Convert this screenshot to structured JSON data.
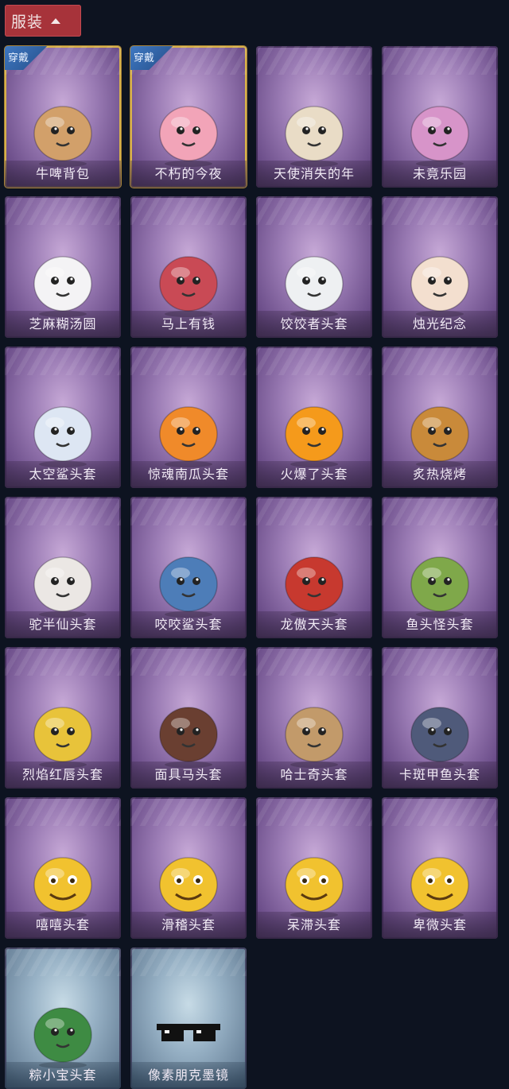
{
  "header": {
    "title": "服装",
    "chevron_icon": "chevron-up-icon"
  },
  "equipped_tag": "穿戴",
  "items": [
    {
      "name": "牛啤背包",
      "icon": "cow-barrel-backpack-icon",
      "theme": "purple",
      "equipped": true,
      "color": "#d2a06a"
    },
    {
      "name": "不朽的今夜",
      "icon": "pink-fox-bowl-icon",
      "theme": "purple",
      "equipped": true,
      "color": "#f2a4b8"
    },
    {
      "name": "天使消失的年",
      "icon": "angel-girl-icon",
      "theme": "purple",
      "equipped": false,
      "color": "#e9dcc6"
    },
    {
      "name": "未竟乐园",
      "icon": "fairy-girl-icon",
      "theme": "purple",
      "equipped": false,
      "color": "#d794c9"
    },
    {
      "name": "芝麻糊汤圆",
      "icon": "dumpling-head-icon",
      "theme": "purple",
      "equipped": false,
      "color": "#f4f3f5"
    },
    {
      "name": "马上有钱",
      "icon": "red-horse-head-icon",
      "theme": "purple",
      "equipped": false,
      "color": "#c94a55"
    },
    {
      "name": "饺饺者头套",
      "icon": "cloud-head-icon",
      "theme": "purple",
      "equipped": false,
      "color": "#eef0f2"
    },
    {
      "name": "烛光纪念",
      "icon": "candle-head-icon",
      "theme": "purple",
      "equipped": false,
      "color": "#f3dfcf"
    },
    {
      "name": "太空鲨头套",
      "icon": "space-shark-head-icon",
      "theme": "purple",
      "equipped": false,
      "color": "#dde6f3"
    },
    {
      "name": "惊魂南瓜头套",
      "icon": "pumpkin-head-icon",
      "theme": "purple",
      "equipped": false,
      "color": "#f08a2a"
    },
    {
      "name": "火爆了头套",
      "icon": "fire-head-icon",
      "theme": "purple",
      "equipped": false,
      "color": "#f59a1b"
    },
    {
      "name": "炙热烧烤",
      "icon": "bbq-head-icon",
      "theme": "purple",
      "equipped": false,
      "color": "#c98a3a"
    },
    {
      "name": "驼半仙头套",
      "icon": "bear-sunglasses-head-icon",
      "theme": "purple",
      "equipped": false,
      "color": "#ebe7e4"
    },
    {
      "name": "咬咬鲨头套",
      "icon": "shark-head-icon",
      "theme": "purple",
      "equipped": false,
      "color": "#4d7db8"
    },
    {
      "name": "龙傲天头套",
      "icon": "dragon-head-icon",
      "theme": "purple",
      "equipped": false,
      "color": "#c7392f"
    },
    {
      "name": "鱼头怪头套",
      "icon": "fish-head-icon",
      "theme": "purple",
      "equipped": false,
      "color": "#7fa84a"
    },
    {
      "name": "烈焰红唇头套",
      "icon": "yellow-mouse-head-icon",
      "theme": "purple",
      "equipped": false,
      "color": "#e8c33a"
    },
    {
      "name": "面具马头套",
      "icon": "horse-mask-icon",
      "theme": "purple",
      "equipped": false,
      "color": "#6a3f31"
    },
    {
      "name": "哈士奇头套",
      "icon": "dog-head-icon",
      "theme": "purple",
      "equipped": false,
      "color": "#c29a6a"
    },
    {
      "name": "卡斑甲鱼头套",
      "icon": "whale-head-icon",
      "theme": "purple",
      "equipped": false,
      "color": "#4f5a7a"
    },
    {
      "name": "嘻嘻头套",
      "icon": "grin-emoji-head-icon",
      "theme": "purple",
      "equipped": false,
      "color": "#f1c22f"
    },
    {
      "name": "滑稽头套",
      "icon": "smirk-emoji-head-icon",
      "theme": "purple",
      "equipped": false,
      "color": "#f1c22f"
    },
    {
      "name": "呆滞头套",
      "icon": "dazed-emoji-head-icon",
      "theme": "purple",
      "equipped": false,
      "color": "#f1c22f"
    },
    {
      "name": "卑微头套",
      "icon": "humble-emoji-head-icon",
      "theme": "purple",
      "equipped": false,
      "color": "#f1c22f"
    },
    {
      "name": "粽小宝头套",
      "icon": "zongzi-head-icon",
      "theme": "blue",
      "equipped": false,
      "color": "#3e8b43"
    },
    {
      "name": "像素朋克墨镜",
      "icon": "pixel-sunglasses-icon",
      "theme": "blue",
      "equipped": false,
      "color": "#1c1c1c"
    }
  ]
}
